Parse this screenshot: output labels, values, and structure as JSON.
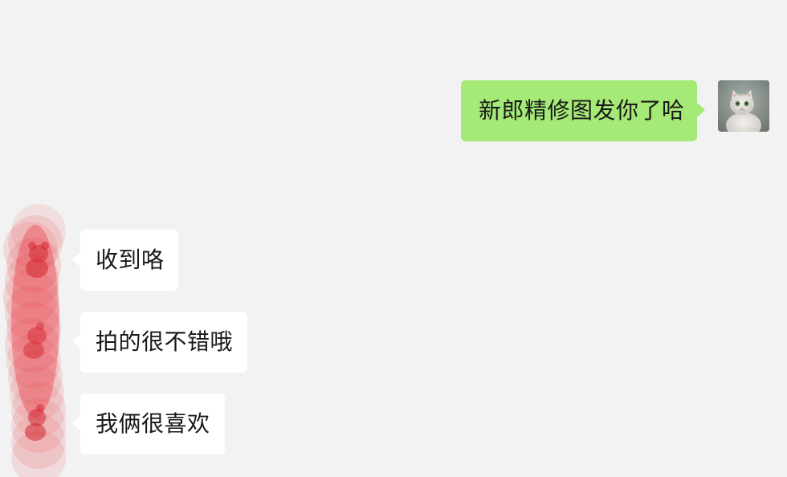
{
  "conversation": {
    "outgoing": [
      {
        "text": "新郎精修图发你了哈"
      }
    ],
    "incoming": [
      {
        "text": "收到咯"
      },
      {
        "text": "拍的很不错哦"
      },
      {
        "text": "我俩很喜欢"
      }
    ]
  },
  "colors": {
    "background": "#f2f2f2",
    "outgoing_bubble": "#a5e977",
    "incoming_bubble": "#ffffff",
    "avatar_blur_red": "#e8323a"
  },
  "icons": {
    "self_avatar": "cat-avatar-icon",
    "contact_avatar": "bear-avatar-icon"
  }
}
